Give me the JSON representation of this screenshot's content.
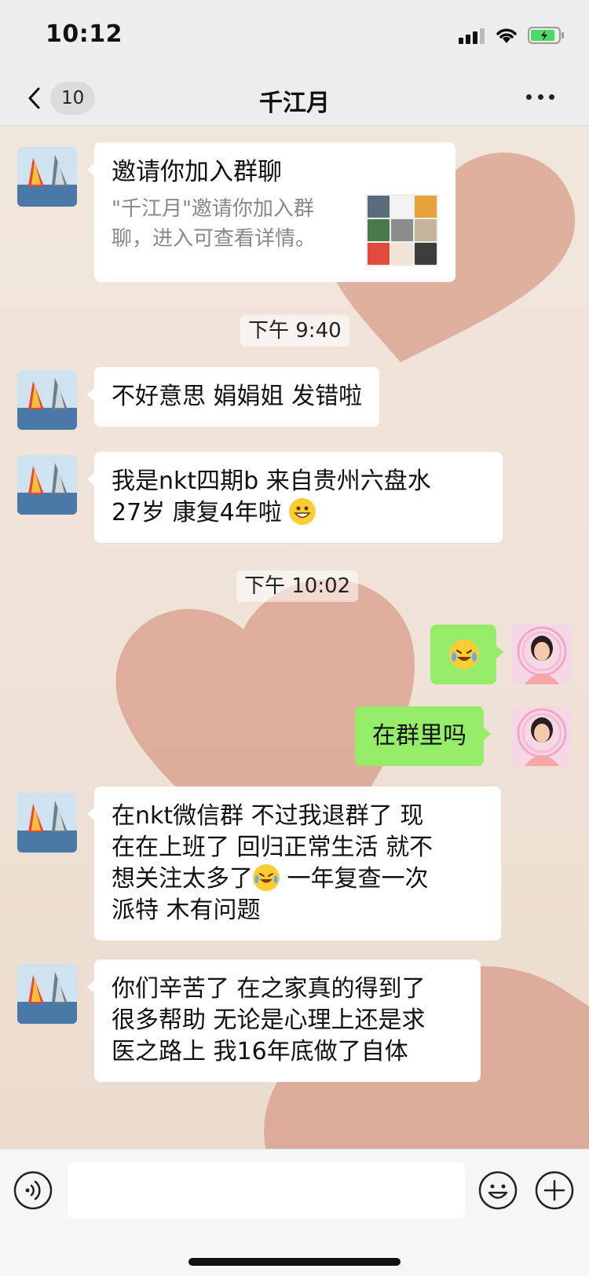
{
  "status_bar": {
    "time": "10:12"
  },
  "header": {
    "back_badge": "10",
    "title": "千江月"
  },
  "messages": {
    "invite": {
      "title": "邀请你加入群聊",
      "description": "\"千江月\"邀请你加入群聊，进入可查看详情。"
    },
    "time1": "下午 9:40",
    "m1": "不好意思 娟娟姐  发错啦",
    "m2_line1": "我是nkt四期b  来自贵州六盘水",
    "m2_line2": "27岁  康复4年啦",
    "time2": "下午 10:02",
    "m4": "在群里吗",
    "m5_line1": "在nkt微信群   不过我退群了  现",
    "m5_line2": "在在上班了  回归正常生活 就不",
    "m5_line3a": "想关注太多了",
    "m5_line3b": "    一年复查一次",
    "m5_line4": "派特  木有问题",
    "m6_line1": "你们辛苦了  在之家真的得到了",
    "m6_line2": "很多帮助  无论是心理上还是求",
    "m6_line3": "医之路上  我16年底做了自体"
  },
  "input": {
    "value": "",
    "placeholder": ""
  },
  "colors": {
    "self_bubble": "#95ec69",
    "other_bubble": "#ffffff",
    "bar_bg": "#ededed"
  },
  "icons": {
    "back": "chevron-left-icon",
    "more": "more-dots-icon",
    "voice": "voice-icon",
    "emoji": "emoji-icon",
    "plus": "plus-icon"
  }
}
